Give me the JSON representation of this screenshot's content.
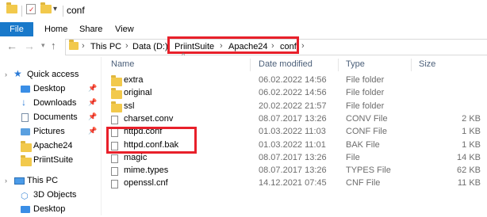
{
  "window": {
    "title": "conf"
  },
  "ribbon": {
    "tabs": [
      "File",
      "Home",
      "Share",
      "View"
    ]
  },
  "address": {
    "crumbs": [
      "This PC",
      "Data (D:)",
      "PriintSuite",
      "Apache24",
      "conf"
    ]
  },
  "nav": {
    "quick_access": "Quick access",
    "items": [
      {
        "label": "Desktop",
        "icon": "desktop-icon",
        "pinned": true
      },
      {
        "label": "Downloads",
        "icon": "downloads-icon",
        "pinned": true
      },
      {
        "label": "Documents",
        "icon": "documents-icon",
        "pinned": true
      },
      {
        "label": "Pictures",
        "icon": "pictures-icon",
        "pinned": true
      },
      {
        "label": "Apache24",
        "icon": "folder-icon",
        "pinned": false
      },
      {
        "label": "PriintSuite",
        "icon": "folder-icon",
        "pinned": false
      }
    ],
    "this_pc": "This PC",
    "pc_items": [
      {
        "label": "3D Objects",
        "icon": "3d-objects-icon"
      },
      {
        "label": "Desktop",
        "icon": "desktop-icon"
      }
    ]
  },
  "columns": {
    "name": "Name",
    "date": "Date modified",
    "type": "Type",
    "size": "Size"
  },
  "files": [
    {
      "name": "extra",
      "date": "06.02.2022 14:56",
      "type": "File folder",
      "size": "",
      "kind": "folder"
    },
    {
      "name": "original",
      "date": "06.02.2022 14:56",
      "type": "File folder",
      "size": "",
      "kind": "folder"
    },
    {
      "name": "ssl",
      "date": "20.02.2022 21:57",
      "type": "File folder",
      "size": "",
      "kind": "folder"
    },
    {
      "name": "charset.conv",
      "date": "08.07.2017 13:26",
      "type": "CONV File",
      "size": "2 KB",
      "kind": "file"
    },
    {
      "name": "httpd.conf",
      "date": "01.03.2022 11:03",
      "type": "CONF File",
      "size": "1 KB",
      "kind": "file"
    },
    {
      "name": "httpd.conf.bak",
      "date": "01.03.2022 11:01",
      "type": "BAK File",
      "size": "1 KB",
      "kind": "file"
    },
    {
      "name": "magic",
      "date": "08.07.2017 13:26",
      "type": "File",
      "size": "14 KB",
      "kind": "file"
    },
    {
      "name": "mime.types",
      "date": "08.07.2017 13:26",
      "type": "TYPES File",
      "size": "62 KB",
      "kind": "file"
    },
    {
      "name": "openssl.cnf",
      "date": "14.12.2021 07:45",
      "type": "CNF File",
      "size": "11 KB",
      "kind": "file"
    }
  ],
  "colors": {
    "accent": "#1979ca",
    "highlight_box": "#e8202a",
    "folder": "#f2c94c"
  }
}
